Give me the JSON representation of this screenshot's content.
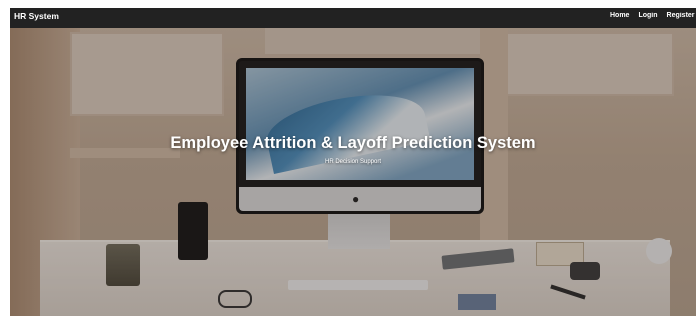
{
  "navbar": {
    "brand": "HR System",
    "links": [
      "Home",
      "Login",
      "Register"
    ]
  },
  "hero": {
    "title": "Employee Attrition & Layoff Prediction System",
    "subtitle": "HR Decision Support"
  },
  "colors": {
    "navbar_bg": "#222222",
    "text": "#ffffff"
  }
}
